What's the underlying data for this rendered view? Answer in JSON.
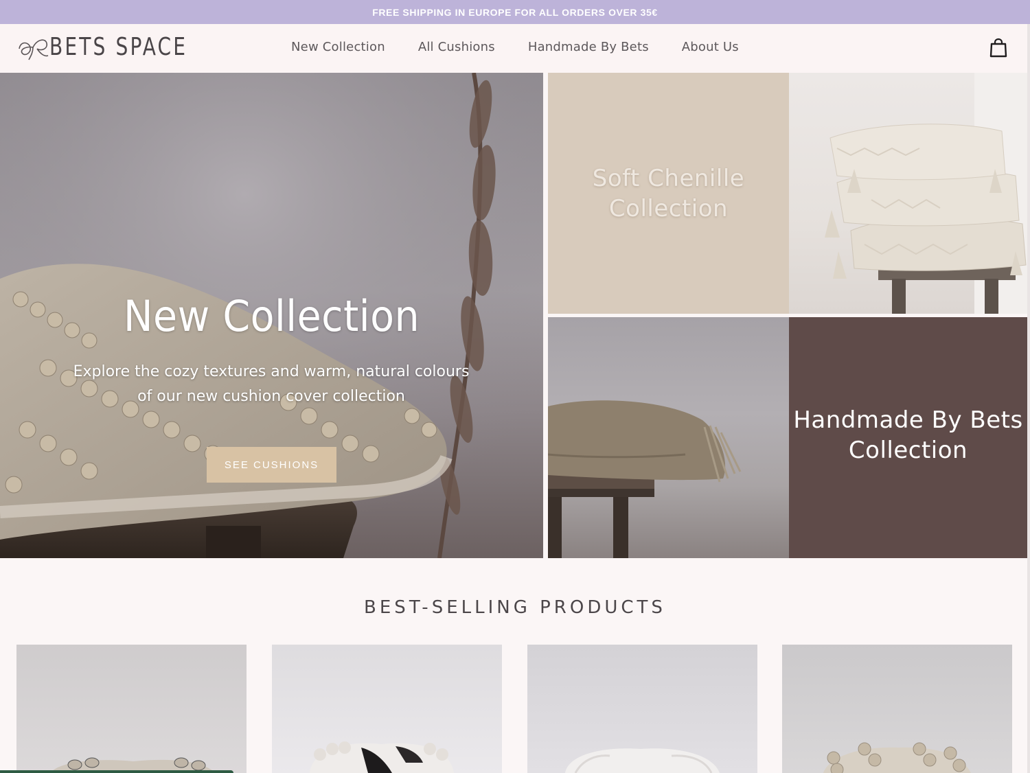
{
  "announcement": {
    "text": "FREE SHIPPING IN EUROPE FOR ALL ORDERS OVER 35€"
  },
  "header": {
    "brand": "BETS SPACE",
    "nav": [
      {
        "label": "New Collection"
      },
      {
        "label": "All Cushions"
      },
      {
        "label": "Handmade By Bets"
      },
      {
        "label": "About Us"
      }
    ],
    "cart_icon": "shopping-bag-icon"
  },
  "hero": {
    "title": "New Collection",
    "subtitle_line1": "Explore the cozy textures and warm, natural colours",
    "subtitle_line2": "of our new cushion cover collection",
    "button_label": "SEE CUSHIONS"
  },
  "tiles": [
    {
      "line1": "Soft Chenille",
      "line2": "Collection"
    },
    {
      "line1": "Handmade By Bets",
      "line2": "Collection"
    }
  ],
  "best_selling": {
    "title": "BEST-SELLING PRODUCTS"
  },
  "colors": {
    "announcement_bg": "#bdb3d9",
    "header_bg": "#fbf4f4",
    "button_bg": "#d8c2a4",
    "chenille_panel": "#d8cbbc",
    "handmade_panel": "#5f4b49"
  }
}
